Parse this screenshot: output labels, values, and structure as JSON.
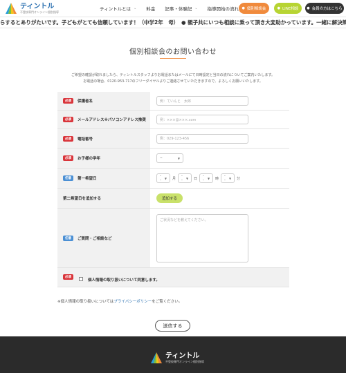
{
  "header": {
    "logo_name": "ティントル",
    "logo_sub": "不登校専門オンライン個別指導",
    "nav": [
      {
        "label": "ティントルとは",
        "chevron": true
      },
      {
        "label": "料金",
        "chevron": false
      },
      {
        "label": "記事・体験記",
        "chevron": true
      },
      {
        "label": "指導開始の流れ",
        "chevron": false
      }
    ],
    "buttons": {
      "consult": "個別相談会",
      "line": "LINE相談",
      "member": "会員の方はこちら"
    }
  },
  "ticker": {
    "text": "らするとありがたいです。子どもがとても信頼しています！（中学2年　母）　● 親子共にいつも相談に乗って頂き大変助かっています。一緒に解決策パ"
  },
  "main": {
    "title": "個別相談会のお問い合わせ",
    "intro_line1": "ご希望の確認が取れましたら、ティントルスタッフよりお電話またはメールにて日時設定と当日の流れについてご案内いたします。",
    "intro_line2": "お電話の場合、0120-953-717のフリーダイヤルよりご連絡させていただきますので、よろしくお願いいたします。"
  },
  "form": {
    "badge_required": "必須",
    "badge_optional": "任意",
    "guardian_label": "保護者名",
    "guardian_placeholder": "例：ていんと　太郎",
    "email_label": "メールアドレス※パソコンアドレス推奨",
    "email_placeholder": "例：×××@×××.com",
    "phone_label": "電話番号",
    "phone_placeholder": "例：029-123-456",
    "grade_label": "お子様の学年",
    "grade_value": "--",
    "date_label": "第一希望日",
    "date_value": "--",
    "unit_month": "月",
    "unit_day": "日",
    "unit_hour": "時",
    "unit_minute": "分",
    "second_date_label": "第二希望日を追加する",
    "add_button": "追加する",
    "question_label": "ご質問・ご相談など",
    "question_placeholder": "ご状況などを教えてください。",
    "agree_text": "個人情報の取り扱いについて同意します。",
    "privacy_prefix": "※個人情報の取り扱いについては",
    "privacy_link": "プライバシーポリシー",
    "privacy_suffix": "をご覧ください。",
    "submit": "送信する"
  },
  "footer": {
    "logo_name": "ティントル",
    "logo_sub": "不登校専門オンライン個別指導"
  },
  "colors": {
    "accent_orange": "#f08a3c",
    "line_green": "#b7d433",
    "required_red": "#d9343a",
    "optional_blue": "#4a8fd4",
    "footer_dark": "#2b2b2b"
  }
}
